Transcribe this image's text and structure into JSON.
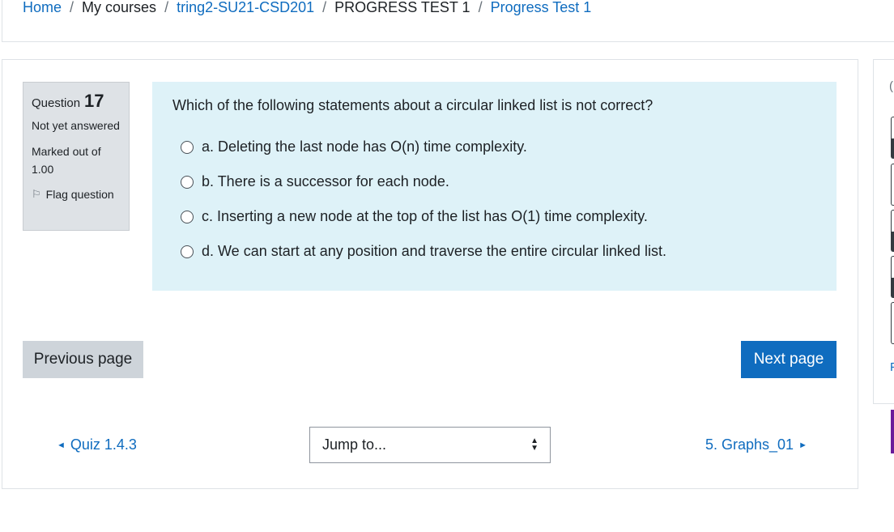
{
  "breadcrumb": {
    "home": "Home",
    "my_courses": "My courses",
    "course": "tring2-SU21-CSD201",
    "section": "PROGRESS TEST 1",
    "quiz": "Progress Test 1",
    "separator": "/"
  },
  "question_info": {
    "label": "Question",
    "number": "17",
    "state": "Not yet answered",
    "grade": "Marked out of 1.00",
    "flag_label": "Flag question"
  },
  "question": {
    "text": "Which of the following statements about a circular linked list is not correct?",
    "answers": [
      "a. Deleting the last node has O(n) time complexity.",
      "b. There is a successor for each node.",
      "c. Inserting a new node at the top of the list has O(1) time complexity.",
      "d. We can start at any position and traverse the entire circular linked list."
    ]
  },
  "buttons": {
    "previous": "Previous page",
    "next": "Next page"
  },
  "activity_nav": {
    "prev_link": "Quiz 1.4.3",
    "next_link": "5. Graphs_01",
    "jump_placeholder": "Jump to..."
  },
  "colors": {
    "link": "#0f6cbf",
    "primary_button": "#0f6cbf",
    "question_bg": "#def2f8",
    "info_bg": "#dee2e6"
  },
  "icons": {
    "flag": "flag-icon",
    "prev_arrow": "triangle-left-icon",
    "next_arrow": "triangle-right-icon",
    "select_arrows": "updown-icon"
  }
}
